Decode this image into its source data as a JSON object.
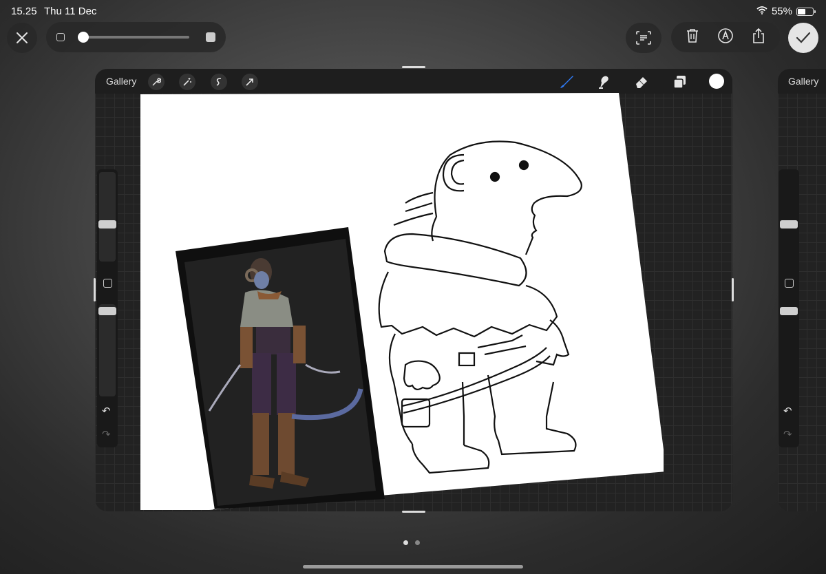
{
  "status_bar": {
    "time": "15.25",
    "date": "Thu 11 Dec",
    "battery_percent": "55%",
    "battery_level": 0.55
  },
  "top_controls": {
    "close_icon": "close-icon",
    "size_slider_value": 0.05,
    "text_recognition_icon": "text-scan-icon",
    "delete_icon": "trash-icon",
    "markup_icon": "pen-circle-icon",
    "share_icon": "share-icon",
    "confirm_icon": "checkmark-icon"
  },
  "main_card": {
    "gallery_label": "Gallery",
    "tools_left": [
      "wrench-icon",
      "magic-wand-icon",
      "selection-icon",
      "transform-arrow-icon"
    ],
    "tools_right": [
      "brush-icon",
      "smudge-icon",
      "eraser-icon",
      "layers-icon"
    ],
    "active_tool": "brush-icon",
    "current_color": "#ffffff",
    "accent_color": "#2f7bf6"
  },
  "second_card": {
    "gallery_label": "Gallery"
  },
  "page_indicator": {
    "count": 2,
    "active": 0
  }
}
